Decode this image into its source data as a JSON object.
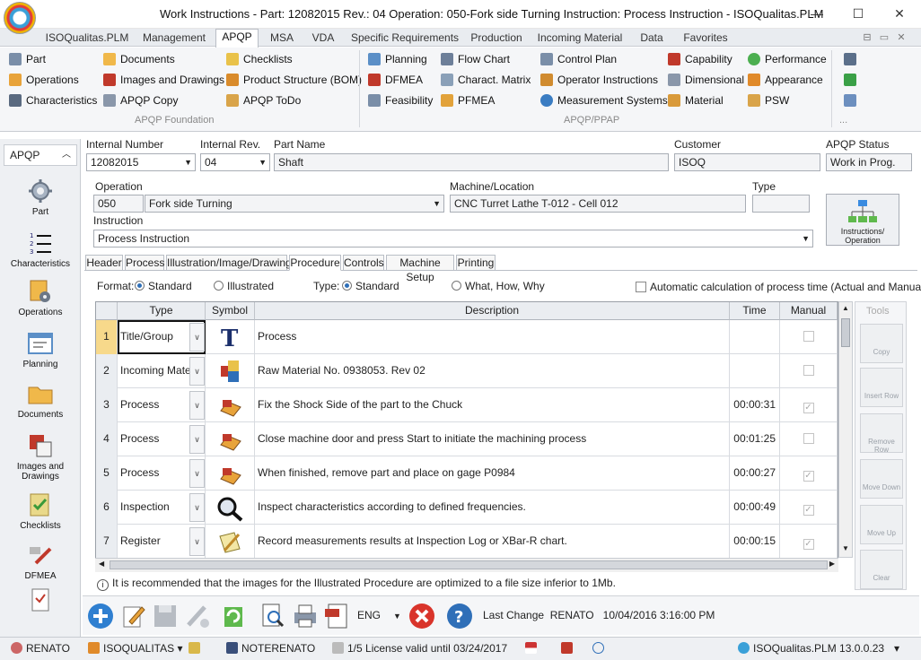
{
  "window": {
    "title": "Work Instructions   -  Part: 12082015 Rev.: 04 Operation: 050-Fork side Turning Instruction: Process Instruction  - ISOQualitas.PLM",
    "minimize": "—",
    "maximize": "☐",
    "close": "✕"
  },
  "menu": [
    "ISOQualitas.PLM",
    "Management",
    "APQP",
    "MSA",
    "VDA",
    "Specific Requirements",
    "Production",
    "Incoming Material",
    "Data",
    "Favorites"
  ],
  "ribbon": {
    "foundation": {
      "label": "APQP Foundation",
      "col1": [
        "Part",
        "Operations",
        "Characteristics"
      ],
      "col2": [
        "Documents",
        "Images and Drawings",
        "APQP Copy"
      ],
      "col3": [
        "Checklists",
        "Product Structure (BOM)",
        "APQP ToDo"
      ]
    },
    "ppap": {
      "label": "APQP/PPAP",
      "col1": [
        "Planning",
        "DFMEA",
        "Feasibility"
      ],
      "col2": [
        "Flow Chart",
        "Charact. Matrix",
        "PFMEA"
      ],
      "col3": [
        "Control Plan",
        "Operator Instructions",
        "Measurement Systems"
      ],
      "col4": [
        "Capability",
        "Dimensional",
        "Material"
      ],
      "col5": [
        "Performance",
        "Appearance",
        "PSW"
      ]
    },
    "more": "..."
  },
  "leftnav": {
    "header": "APQP",
    "items": [
      "Part",
      "Characteristics",
      "Operations",
      "Planning",
      "Documents",
      "Images and Drawings",
      "Checklists",
      "DFMEA"
    ]
  },
  "header": {
    "internal_number_label": "Internal Number",
    "internal_number": "12082015",
    "internal_rev_label": "Internal Rev.",
    "internal_rev": "04",
    "part_name_label": "Part Name",
    "part_name": "Shaft",
    "customer_label": "Customer",
    "customer": "ISOQ",
    "apqp_status_label": "APQP Status",
    "apqp_status": "Work in Prog.",
    "operation_label": "Operation",
    "operation_code": "050",
    "operation_name": "Fork side Turning",
    "machine_label": "Machine/Location",
    "machine": "CNC Turret Lathe  T-012 -  Cell 012",
    "type_label": "Type",
    "type": "",
    "instruction_label": "Instruction",
    "instruction": "Process Instruction",
    "instr_button": "Instructions/ Operation"
  },
  "subtabs": [
    "Header",
    "Process",
    "Illustration/Image/Drawing",
    "Procedure",
    "Controls",
    "Machine Setup",
    "Printing"
  ],
  "options": {
    "format_label": "Format:",
    "standard": "Standard",
    "illustrated": "Illustrated",
    "type_label": "Type:",
    "type_standard": "Standard",
    "what_how_why": "What, How, Why",
    "auto_calc": "Automatic calculation of process time (Actual and Manual)"
  },
  "grid": {
    "headers": [
      "Type",
      "Symbol",
      "Description",
      "Time",
      "Manual"
    ],
    "rows": [
      {
        "num": "1",
        "type": "Title/Group",
        "symbol": "title-symbol",
        "desc": "Process",
        "time": "",
        "manual": false
      },
      {
        "num": "2",
        "type": "Incoming Material",
        "symbol": "raw-material-symbol",
        "desc": "Raw Material No. 0938053. Rev 02",
        "time": "",
        "manual": false
      },
      {
        "num": "3",
        "type": "Process",
        "symbol": "process-symbol",
        "desc": "Fix the Shock Side of the part to the Chuck",
        "time": "00:00:31",
        "manual": true
      },
      {
        "num": "4",
        "type": "Process",
        "symbol": "process-symbol",
        "desc": "Close machine door and press Start to initiate the machining process",
        "time": "00:01:25",
        "manual": false
      },
      {
        "num": "5",
        "type": "Process",
        "symbol": "process-symbol",
        "desc": "When finished, remove part and place on gage P0984",
        "time": "00:00:27",
        "manual": true
      },
      {
        "num": "6",
        "type": "Inspection",
        "symbol": "inspection-symbol",
        "desc": "Inspect characteristics according to defined frequencies.",
        "time": "00:00:49",
        "manual": true
      },
      {
        "num": "7",
        "type": "Register",
        "symbol": "register-symbol",
        "desc": "Record measurements results at Inspection Log or XBar-R chart.",
        "time": "00:00:15",
        "manual": true
      }
    ]
  },
  "tools": {
    "title": "Tools",
    "buttons": [
      "Copy",
      "Insert Row",
      "Remove Row",
      "Move Down",
      "Move Up",
      "Clear"
    ]
  },
  "info": "It is recommended that the images for the Illustrated Procedure are optimized to a file size inferior to 1Mb.",
  "bottom": {
    "language": "ENG",
    "last_change_label": "Last Change",
    "last_change_user": "RENATO",
    "last_change_date": "10/04/2016 3:16:00 PM"
  },
  "status": {
    "user": "RENATO",
    "company": "ISOQUALITAS",
    "station": "NOTERENATO",
    "license": "1/5 License valid until 03/24/2017",
    "product": "ISOQualitas.PLM 13.0.0.23"
  },
  "colors": {
    "accent": "#2f6fb8",
    "selected_row": "#f7d98b",
    "header_bg": "#eaedf1"
  }
}
